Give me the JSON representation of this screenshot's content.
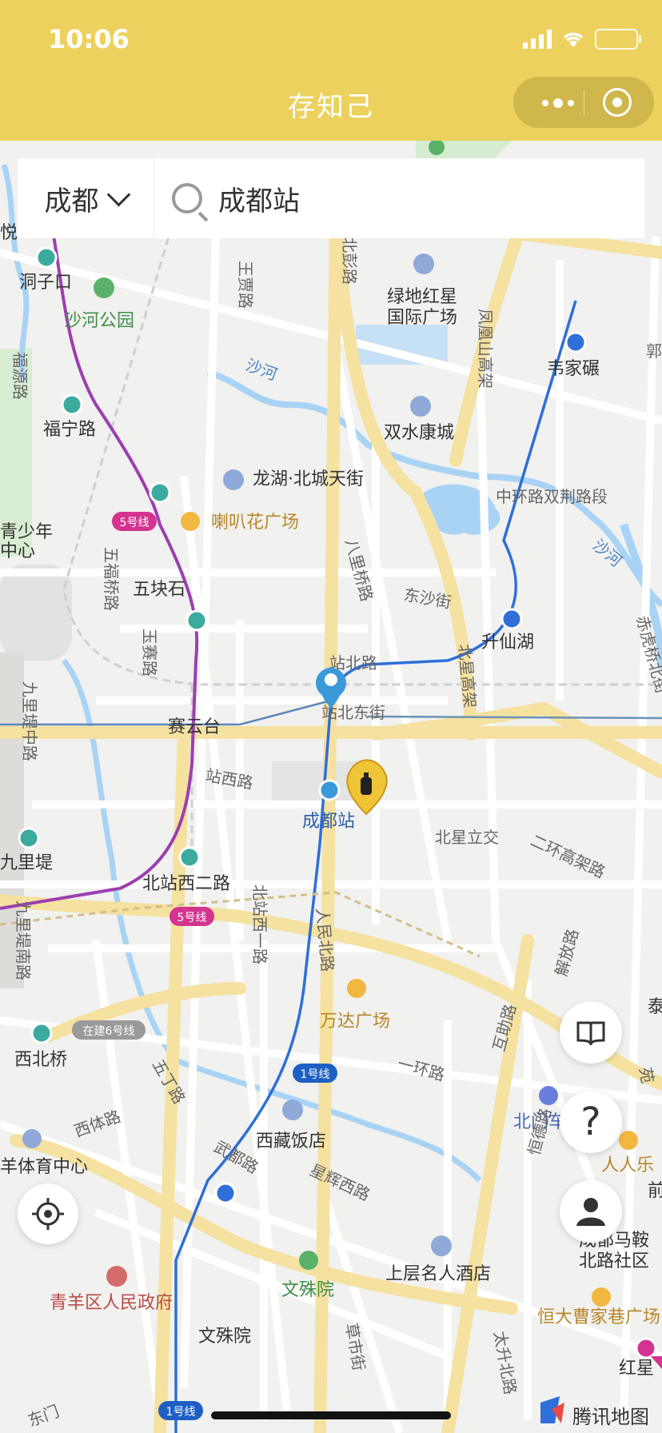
{
  "status_bar": {
    "time": "10:06"
  },
  "nav": {
    "title": "存知己"
  },
  "search": {
    "city": "成都",
    "query": "成都站"
  },
  "map": {
    "attribution": "腾讯地图",
    "labels": [
      {
        "text": "洞子口",
        "kind": "station"
      },
      {
        "text": "沙河公园",
        "kind": "park"
      },
      {
        "text": "福源路",
        "kind": "road"
      },
      {
        "text": "福宁路",
        "kind": "station"
      },
      {
        "text": "青少年",
        "kind": "place"
      },
      {
        "text": "中心",
        "kind": "place"
      },
      {
        "text": "五块石",
        "kind": "station"
      },
      {
        "text": "五福桥路",
        "kind": "road"
      },
      {
        "text": "玉赛路",
        "kind": "road"
      },
      {
        "text": "九里堤中路",
        "kind": "road"
      },
      {
        "text": "赛云台",
        "kind": "station"
      },
      {
        "text": "站西路",
        "kind": "road"
      },
      {
        "text": "九里堤",
        "kind": "station"
      },
      {
        "text": "北站西二路",
        "kind": "station"
      },
      {
        "text": "九里堤南路",
        "kind": "road"
      },
      {
        "text": "北站西一路",
        "kind": "road"
      },
      {
        "text": "西北桥",
        "kind": "station"
      },
      {
        "text": "王贾路",
        "kind": "road"
      },
      {
        "text": "北彭路",
        "kind": "road"
      },
      {
        "text": "绿地红星",
        "kind": "poi"
      },
      {
        "text": "国际广场",
        "kind": "poi"
      },
      {
        "text": "凤凰山高架",
        "kind": "road"
      },
      {
        "text": "韦家碾",
        "kind": "station"
      },
      {
        "text": "沙河",
        "kind": "river"
      },
      {
        "text": "双水康城",
        "kind": "poi"
      },
      {
        "text": "龙湖·北城天街",
        "kind": "poi"
      },
      {
        "text": "中环路双荆路段",
        "kind": "road"
      },
      {
        "text": "喇叭花广场",
        "kind": "shop"
      },
      {
        "text": "八里桥路",
        "kind": "road"
      },
      {
        "text": "东沙街",
        "kind": "road"
      },
      {
        "text": "沙河",
        "kind": "river"
      },
      {
        "text": "升仙湖",
        "kind": "station"
      },
      {
        "text": "赤虎桥北街",
        "kind": "road"
      },
      {
        "text": "站北路",
        "kind": "road"
      },
      {
        "text": "北星高架",
        "kind": "road"
      },
      {
        "text": "站北东街",
        "kind": "road"
      },
      {
        "text": "成都站",
        "kind": "station-main"
      },
      {
        "text": "北星立交",
        "kind": "road"
      },
      {
        "text": "二环高架路",
        "kind": "road"
      },
      {
        "text": "人民北路",
        "kind": "road"
      },
      {
        "text": "万达广场",
        "kind": "shop"
      },
      {
        "text": "解放路",
        "kind": "road"
      },
      {
        "text": "一环路",
        "kind": "road"
      },
      {
        "text": "互助路",
        "kind": "road"
      },
      {
        "text": "北门车",
        "kind": "poi-blue"
      },
      {
        "text": "恒德路",
        "kind": "road"
      },
      {
        "text": "人人乐",
        "kind": "shop"
      },
      {
        "text": "五丁路",
        "kind": "road"
      },
      {
        "text": "西体路",
        "kind": "road"
      },
      {
        "text": "西藏饭店",
        "kind": "poi"
      },
      {
        "text": "武都路",
        "kind": "road"
      },
      {
        "text": "星辉西路",
        "kind": "road"
      },
      {
        "text": "羊体育中心",
        "kind": "place"
      },
      {
        "text": "成都马鞍",
        "kind": "poi"
      },
      {
        "text": "北路社区",
        "kind": "poi"
      },
      {
        "text": "青羊区人民政府",
        "kind": "gov"
      },
      {
        "text": "文殊院",
        "kind": "park"
      },
      {
        "text": "上层名人酒店",
        "kind": "poi"
      },
      {
        "text": "恒大曹家巷广场",
        "kind": "shop"
      },
      {
        "text": "文殊院",
        "kind": "station"
      },
      {
        "text": "草市街",
        "kind": "road"
      },
      {
        "text": "太升北路",
        "kind": "road"
      },
      {
        "text": "红星",
        "kind": "station"
      },
      {
        "text": "前",
        "kind": "place"
      },
      {
        "text": "泰",
        "kind": "place"
      },
      {
        "text": "东门",
        "kind": "road"
      },
      {
        "text": "苑",
        "kind": "road"
      },
      {
        "text": "悦",
        "kind": "place"
      },
      {
        "text": "郭",
        "kind": "place"
      }
    ],
    "badges": [
      {
        "text": "5号线",
        "color": "#d4338f"
      },
      {
        "text": "5号线",
        "color": "#d4338f"
      },
      {
        "text": "在建6号线",
        "color": "#9a9a9a"
      },
      {
        "text": "1号线",
        "color": "#1f5fc4"
      },
      {
        "text": "1号线",
        "color": "#1f5fc4"
      }
    ],
    "colors": {
      "metro_line_1": "#2e6fd8",
      "metro_line_5": "#9b3fb0",
      "water": "#a9d3f5",
      "arterial": "#f5e1a0",
      "accent": "#ecd15f"
    }
  },
  "buttons": {
    "manual": "book-icon",
    "help": "?",
    "user": "user-icon",
    "locate": "locate-icon"
  }
}
